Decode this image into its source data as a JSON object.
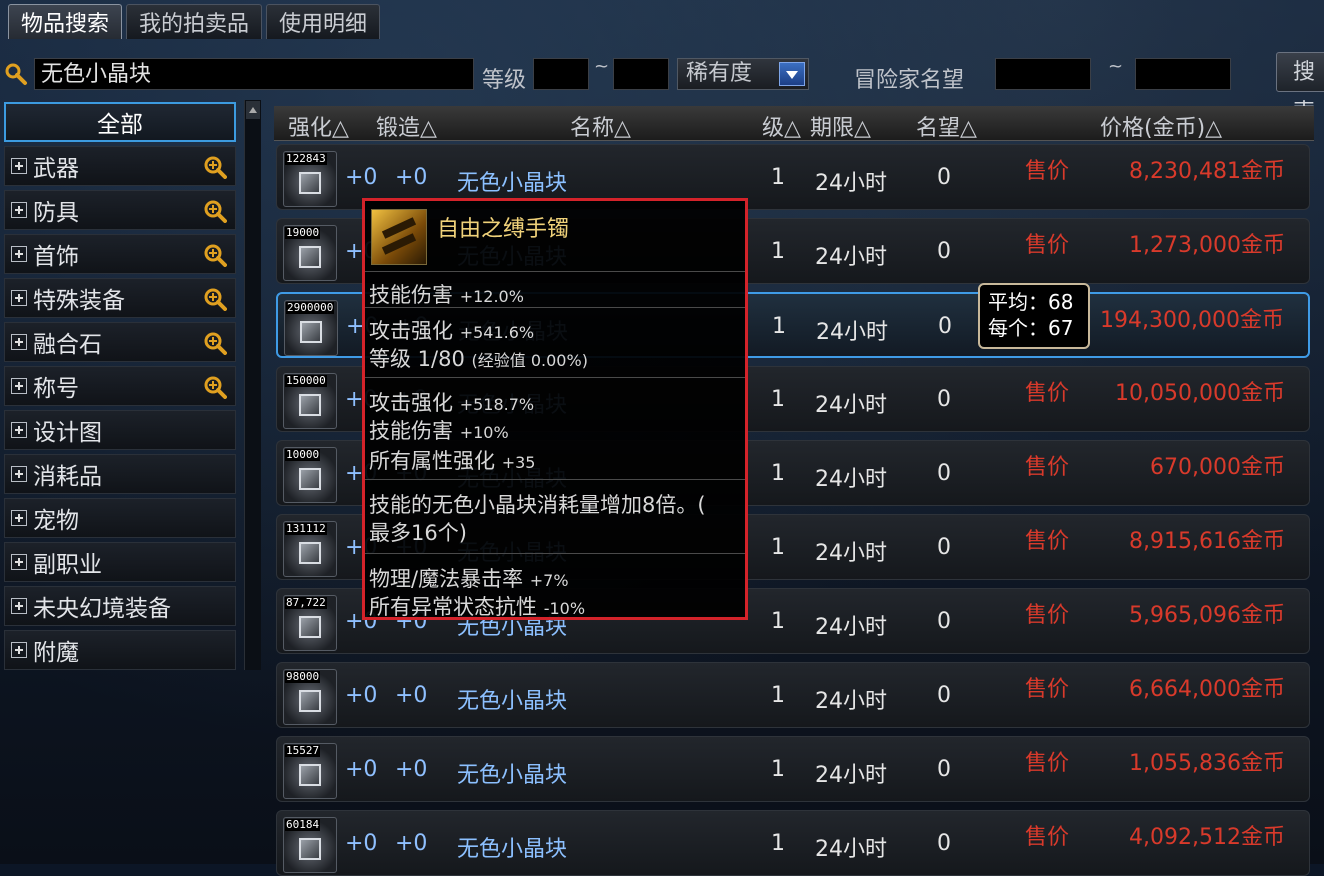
{
  "tabs": [
    "物品搜索",
    "我的拍卖品",
    "使用明细"
  ],
  "search": {
    "value": "无色小晶块",
    "level_label": "等级",
    "tilde": "~",
    "rarity_label": "稀有度",
    "fame_label": "冒险家名望",
    "button": "搜索"
  },
  "sidebar": {
    "all": "全部",
    "items": [
      {
        "label": "武器"
      },
      {
        "label": "防具"
      },
      {
        "label": "首饰"
      },
      {
        "label": "特殊装备"
      },
      {
        "label": "融合石"
      },
      {
        "label": "称号"
      },
      {
        "label": "设计图"
      },
      {
        "label": "消耗品"
      },
      {
        "label": "宠物"
      },
      {
        "label": "副职业"
      },
      {
        "label": "未央幻境装备"
      },
      {
        "label": "附魔"
      }
    ]
  },
  "table": {
    "headers": {
      "enhance": "强化△",
      "forge": "锻造△",
      "name": "名称△",
      "level": "级△",
      "period": "期限△",
      "fame": "名望△",
      "price": "价格(金币)△"
    },
    "sale_label": "售价",
    "rows": [
      {
        "count": "122843",
        "enhance": "+0",
        "forge": "+0",
        "name": "无色小晶块",
        "level": "1",
        "period": "24小时",
        "fame": "0",
        "price": "8,230,481金币"
      },
      {
        "count": "19000",
        "enhance": "+0",
        "forge": "+0",
        "name": "无色小晶块",
        "level": "1",
        "period": "24小时",
        "fame": "0",
        "price": "1,273,000金币"
      },
      {
        "count": "2900000",
        "enhance": "+0",
        "forge": "+0",
        "name": "无色小晶块",
        "level": "1",
        "period": "24小时",
        "fame": "0",
        "price": "194,300,000金币"
      },
      {
        "count": "150000",
        "enhance": "+0",
        "forge": "+0",
        "name": "无色小晶块",
        "level": "1",
        "period": "24小时",
        "fame": "0",
        "price": "10,050,000金币"
      },
      {
        "count": "10000",
        "enhance": "+0",
        "forge": "+0",
        "name": "无色小晶块",
        "level": "1",
        "period": "24小时",
        "fame": "0",
        "price": "670,000金币"
      },
      {
        "count": "131112",
        "enhance": "+0",
        "forge": "+0",
        "name": "无色小晶块",
        "level": "1",
        "period": "24小时",
        "fame": "0",
        "price": "8,915,616金币"
      },
      {
        "count": "87,722",
        "enhance": "+0",
        "forge": "+0",
        "name": "无色小晶块",
        "level": "1",
        "period": "24小时",
        "fame": "0",
        "price": "5,965,096金币"
      },
      {
        "count": "98000",
        "enhance": "+0",
        "forge": "+0",
        "name": "无色小晶块",
        "level": "1",
        "period": "24小时",
        "fame": "0",
        "price": "6,664,000金币"
      },
      {
        "count": "15527",
        "enhance": "+0",
        "forge": "+0",
        "name": "无色小晶块",
        "level": "1",
        "period": "24小时",
        "fame": "0",
        "price": "1,055,836金币"
      },
      {
        "count": "60184",
        "enhance": "+0",
        "forge": "+0",
        "name": "无色小晶块",
        "level": "1",
        "period": "24小时",
        "fame": "0",
        "price": "4,092,512金币"
      }
    ]
  },
  "avg_tooltip": {
    "line1": "平均：68",
    "line2": "每个：67"
  },
  "item_tooltip": {
    "title": "自由之缚手镯",
    "lines": [
      {
        "k": "技能伤害",
        "v": "+12.0%"
      },
      {
        "k": "攻击强化",
        "v": "+541.6%"
      },
      {
        "k": "等级 1/80",
        "v": "(经验值 0.00%)"
      },
      {
        "k": "攻击强化",
        "v": "+518.7%"
      },
      {
        "k": "技能伤害",
        "v": "+10%"
      },
      {
        "k": "所有属性强化",
        "v": "+35"
      },
      {
        "k": "技能的无色小晶块消耗量增加8倍。(",
        "v": ""
      },
      {
        "k": "最多16个)",
        "v": ""
      },
      {
        "k": "物理/魔法暴击率",
        "v": "+7%"
      },
      {
        "k": "所有异常状态抗性",
        "v": "-10%"
      }
    ]
  },
  "colors": {
    "price_red": "#d93a2b",
    "name_blue": "#8cc0ff",
    "selected_border": "#3f9be6",
    "tooltip_border": "#d4232a",
    "title_gold": "#f0d27a"
  }
}
